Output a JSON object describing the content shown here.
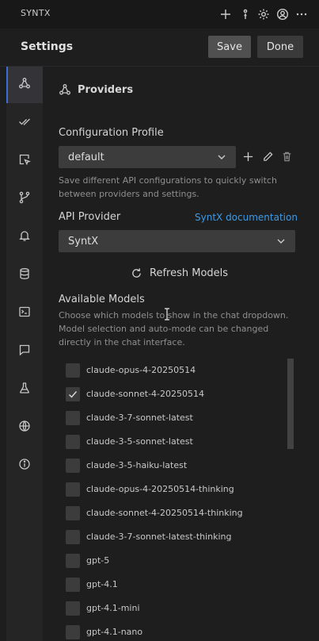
{
  "titlebar": {
    "title": "SYNTX",
    "icons": [
      "plus-icon",
      "history-icon",
      "gear-icon",
      "account-icon",
      "more-icon"
    ]
  },
  "header": {
    "title": "Settings",
    "save_label": "Save",
    "done_label": "Done"
  },
  "sidebar": {
    "items": [
      {
        "icon": "webhook-icon",
        "active": true
      },
      {
        "icon": "double-check-icon",
        "active": false
      },
      {
        "icon": "pointer-square-icon",
        "active": false
      },
      {
        "icon": "git-branch-icon",
        "active": false
      },
      {
        "icon": "bell-icon",
        "active": false
      },
      {
        "icon": "database-icon",
        "active": false
      },
      {
        "icon": "terminal-icon",
        "active": false
      },
      {
        "icon": "chat-icon",
        "active": false
      },
      {
        "icon": "flask-icon",
        "active": false
      },
      {
        "icon": "globe-icon",
        "active": false
      },
      {
        "icon": "info-icon",
        "active": false
      }
    ]
  },
  "providers": {
    "heading": "Providers",
    "config_profile_label": "Configuration Profile",
    "config_profile_value": "default",
    "config_profile_help": "Save different API configurations to quickly switch between providers and settings.",
    "api_provider_label": "API Provider",
    "documentation_link": "SyntX documentation",
    "api_provider_value": "SyntX",
    "refresh_label": "Refresh Models",
    "available_models_label": "Available Models",
    "available_models_help": "Choose which models to show in the chat dropdown. Model selection and auto-mode can be changed directly in the chat interface."
  },
  "models": [
    {
      "name": "claude-opus-4-20250514",
      "checked": false
    },
    {
      "name": "claude-sonnet-4-20250514",
      "checked": true
    },
    {
      "name": "claude-3-7-sonnet-latest",
      "checked": false
    },
    {
      "name": "claude-3-5-sonnet-latest",
      "checked": false
    },
    {
      "name": "claude-3-5-haiku-latest",
      "checked": false
    },
    {
      "name": "claude-opus-4-20250514-thinking",
      "checked": false
    },
    {
      "name": "claude-sonnet-4-20250514-thinking",
      "checked": false
    },
    {
      "name": "claude-3-7-sonnet-latest-thinking",
      "checked": false
    },
    {
      "name": "gpt-5",
      "checked": false
    },
    {
      "name": "gpt-4.1",
      "checked": false
    },
    {
      "name": "gpt-4.1-mini",
      "checked": false
    },
    {
      "name": "gpt-4.1-nano",
      "checked": false
    }
  ],
  "colors": {
    "background": "#1e1e1e",
    "sidebar": "#252526",
    "accent_link": "#3f9ae6",
    "active_indicator": "#3b6fd6"
  }
}
